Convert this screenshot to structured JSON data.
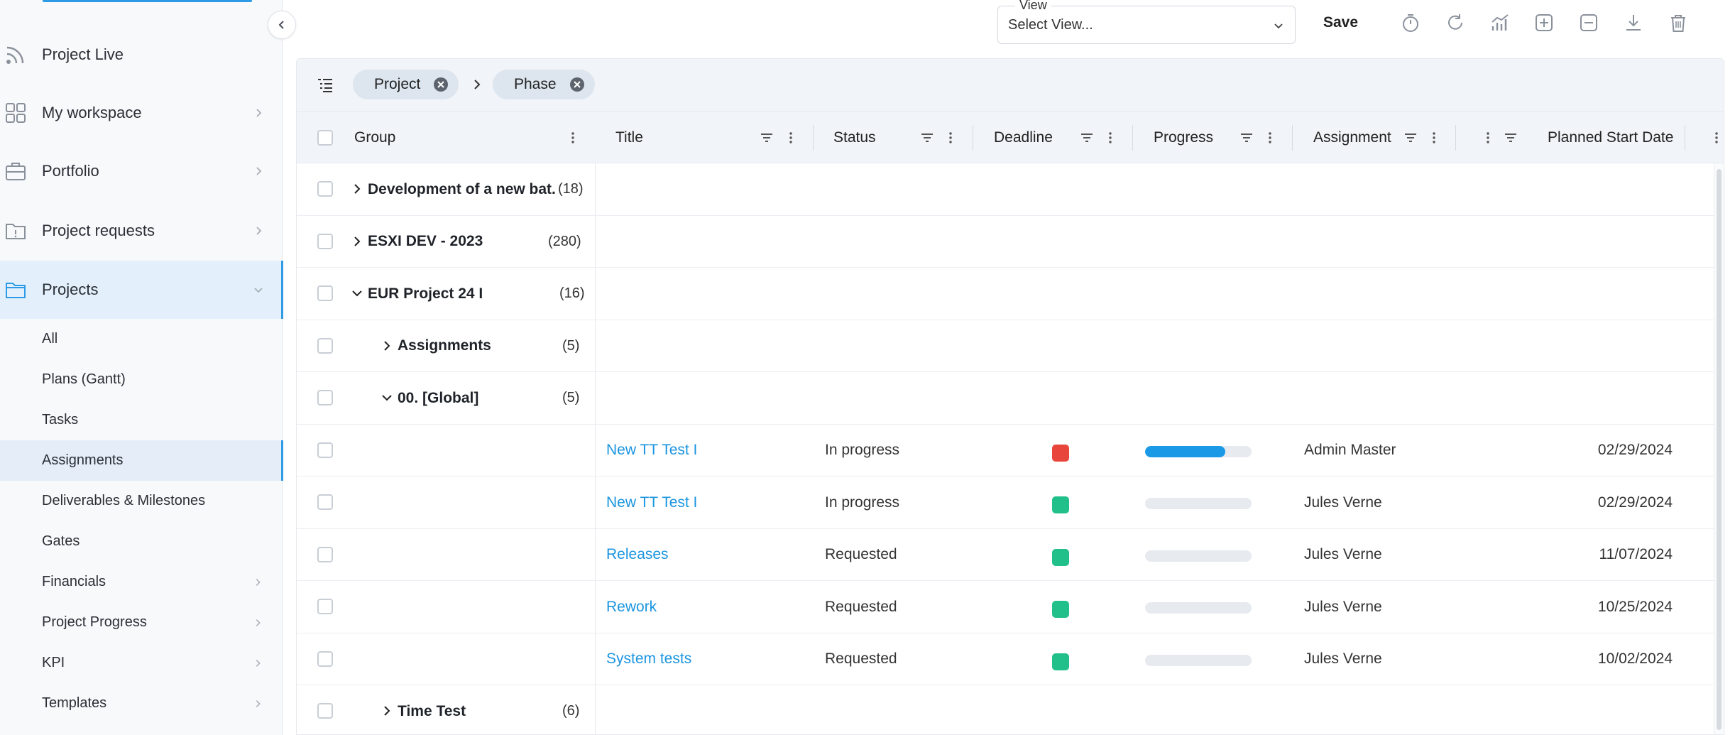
{
  "sidebar": {
    "items": [
      {
        "label": "Project Live",
        "icon": "rss-icon",
        "chevron": false
      },
      {
        "label": "My workspace",
        "icon": "grid-icon",
        "chevron": true
      },
      {
        "label": "Portfolio",
        "icon": "briefcase-icon",
        "chevron": true
      },
      {
        "label": "Project requests",
        "icon": "request-folder-icon",
        "chevron": true
      },
      {
        "label": "Projects",
        "icon": "folder-icon",
        "chevron": true,
        "active": true
      }
    ],
    "sub_items": [
      {
        "label": "All",
        "chevron": false
      },
      {
        "label": "Plans (Gantt)",
        "chevron": false
      },
      {
        "label": "Tasks",
        "chevron": false
      },
      {
        "label": "Assignments",
        "chevron": false,
        "active": true
      },
      {
        "label": "Deliverables & Milestones",
        "chevron": false
      },
      {
        "label": "Gates",
        "chevron": false
      },
      {
        "label": "Financials",
        "chevron": true
      },
      {
        "label": "Project Progress",
        "chevron": true
      },
      {
        "label": "KPI",
        "chevron": true
      },
      {
        "label": "Templates",
        "chevron": true
      }
    ]
  },
  "toolbar": {
    "view_legend": "View",
    "view_placeholder": "Select View...",
    "save_label": "Save",
    "icons": [
      "timer-icon",
      "refresh-icon",
      "chart-icon",
      "expand-all-icon",
      "collapse-all-icon",
      "download-icon",
      "delete-icon"
    ]
  },
  "grouping": {
    "chips": [
      "Project",
      "Phase"
    ]
  },
  "columns": {
    "group": "Group",
    "title": "Title",
    "status": "Status",
    "deadline": "Deadline",
    "progress": "Progress",
    "assignment": "Assignment",
    "planned_start": "Planned Start Date"
  },
  "groups": [
    {
      "name": "Development of a new bat...",
      "count": "(18)",
      "level": 0,
      "expanded": false
    },
    {
      "name": "ESXI DEV - 2023",
      "count": "(280)",
      "level": 0,
      "expanded": false
    },
    {
      "name": "EUR Project 24 I",
      "count": "(16)",
      "level": 0,
      "expanded": true
    },
    {
      "name": "Assignments",
      "count": "(5)",
      "level": 1,
      "expanded": false
    },
    {
      "name": "00. [Global]",
      "count": "(5)",
      "level": 1,
      "expanded": true
    }
  ],
  "rows": [
    {
      "title": "New TT Test I",
      "status": "In progress",
      "deadline_color": "#e8453c",
      "progress": 0.75,
      "assignment": "Admin Master",
      "planned_start": "02/29/2024"
    },
    {
      "title": "New TT Test I",
      "status": "In progress",
      "deadline_color": "#21c08b",
      "progress": 0,
      "assignment": "Jules Verne",
      "planned_start": "02/29/2024"
    },
    {
      "title": "Releases",
      "status": "Requested",
      "deadline_color": "#21c08b",
      "progress": 0,
      "assignment": "Jules Verne",
      "planned_start": "11/07/2024"
    },
    {
      "title": "Rework",
      "status": "Requested",
      "deadline_color": "#21c08b",
      "progress": 0,
      "assignment": "Jules Verne",
      "planned_start": "10/25/2024"
    },
    {
      "title": "System tests",
      "status": "Requested",
      "deadline_color": "#21c08b",
      "progress": 0,
      "assignment": "Jules Verne",
      "planned_start": "10/02/2024"
    }
  ],
  "trailing_group": {
    "name": "Time Test",
    "count": "(6)",
    "level": 1,
    "expanded": false
  }
}
